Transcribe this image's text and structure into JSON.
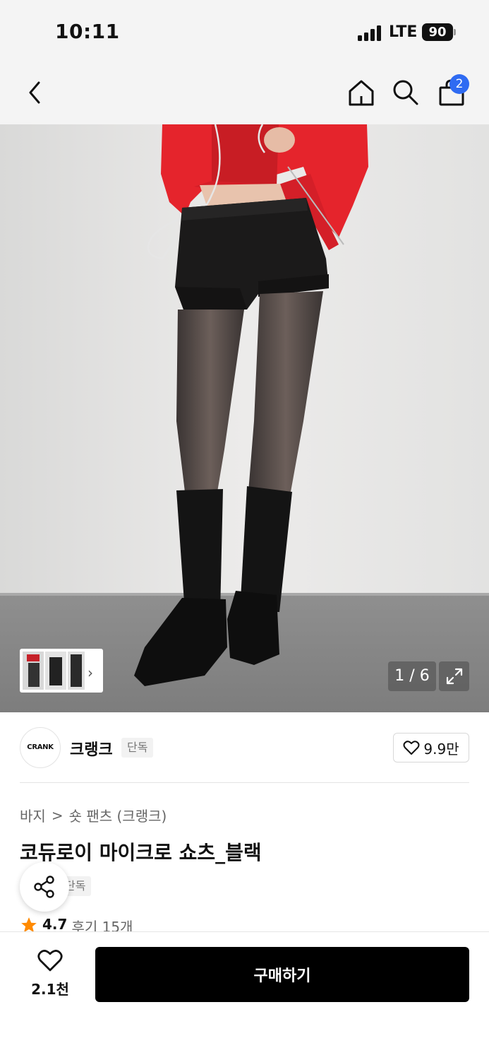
{
  "status_bar": {
    "time": "10:11",
    "network": "LTE",
    "battery": "90"
  },
  "nav": {
    "cart_count": "2"
  },
  "gallery": {
    "counter": "1 / 6"
  },
  "brand": {
    "logo_text": "CRANK",
    "name": "크랭크",
    "tag": "단독",
    "likes": "9.9만"
  },
  "breadcrumb": {
    "category": "바지",
    "separator": ">",
    "subcategory": "숏 팬츠 (크랭크)"
  },
  "product": {
    "title": "코듀로이 마이크로 쇼츠_블랙",
    "exclusive_tag": "단독",
    "rating": "4.7",
    "reviews": "후기 15개"
  },
  "bottom_bar": {
    "wish_count": "2.1천",
    "buy_label": "구매하기"
  },
  "colors": {
    "accent_badge": "#2f6bf2",
    "star": "#ff8a00",
    "jacket": "#e5242c",
    "buy_button": "#000000"
  }
}
